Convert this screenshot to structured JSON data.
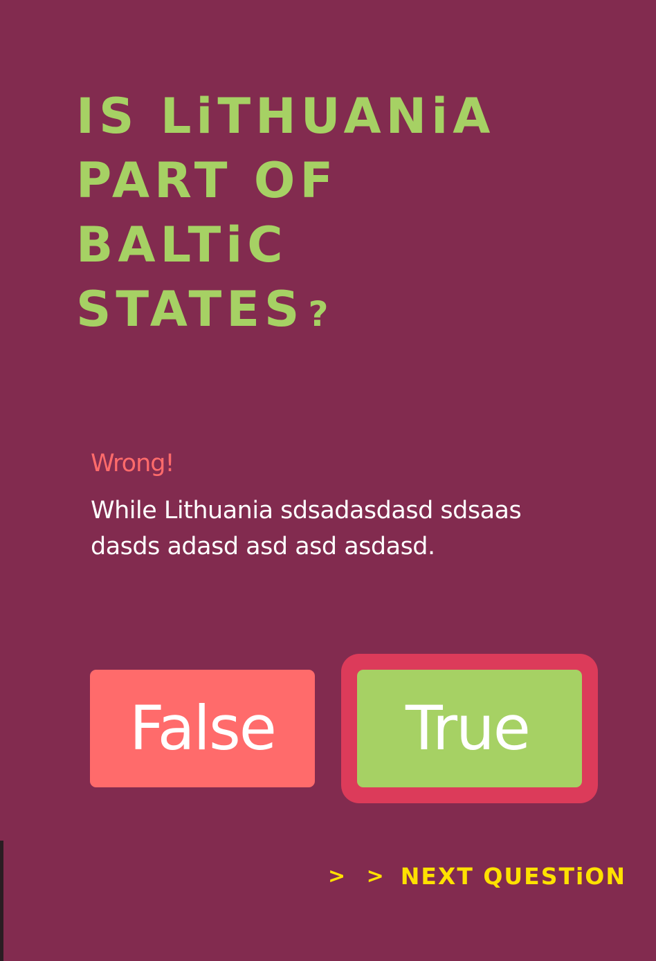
{
  "question": {
    "lines": [
      "IS LiTHUANiA",
      "PART OF",
      "BALTiC",
      "STATES"
    ],
    "question_mark": "?"
  },
  "feedback": {
    "status": "Wrong!",
    "explanation": "While Lithuania sdsadasdasd sdsaas dasds adasd asd asd asdasd."
  },
  "answers": {
    "false_label": "False",
    "true_label": "True",
    "selected": "True"
  },
  "next": {
    "arrows": "> >",
    "label": "NEXT QUESTiON"
  },
  "colors": {
    "background": "#822b4f",
    "question_text": "#a6d164",
    "wrong_text": "#ff6b6b",
    "false_button": "#ff6b6b",
    "true_button": "#a6d164",
    "selected_ring": "#dc3b5a",
    "next_link": "#ffe100"
  }
}
